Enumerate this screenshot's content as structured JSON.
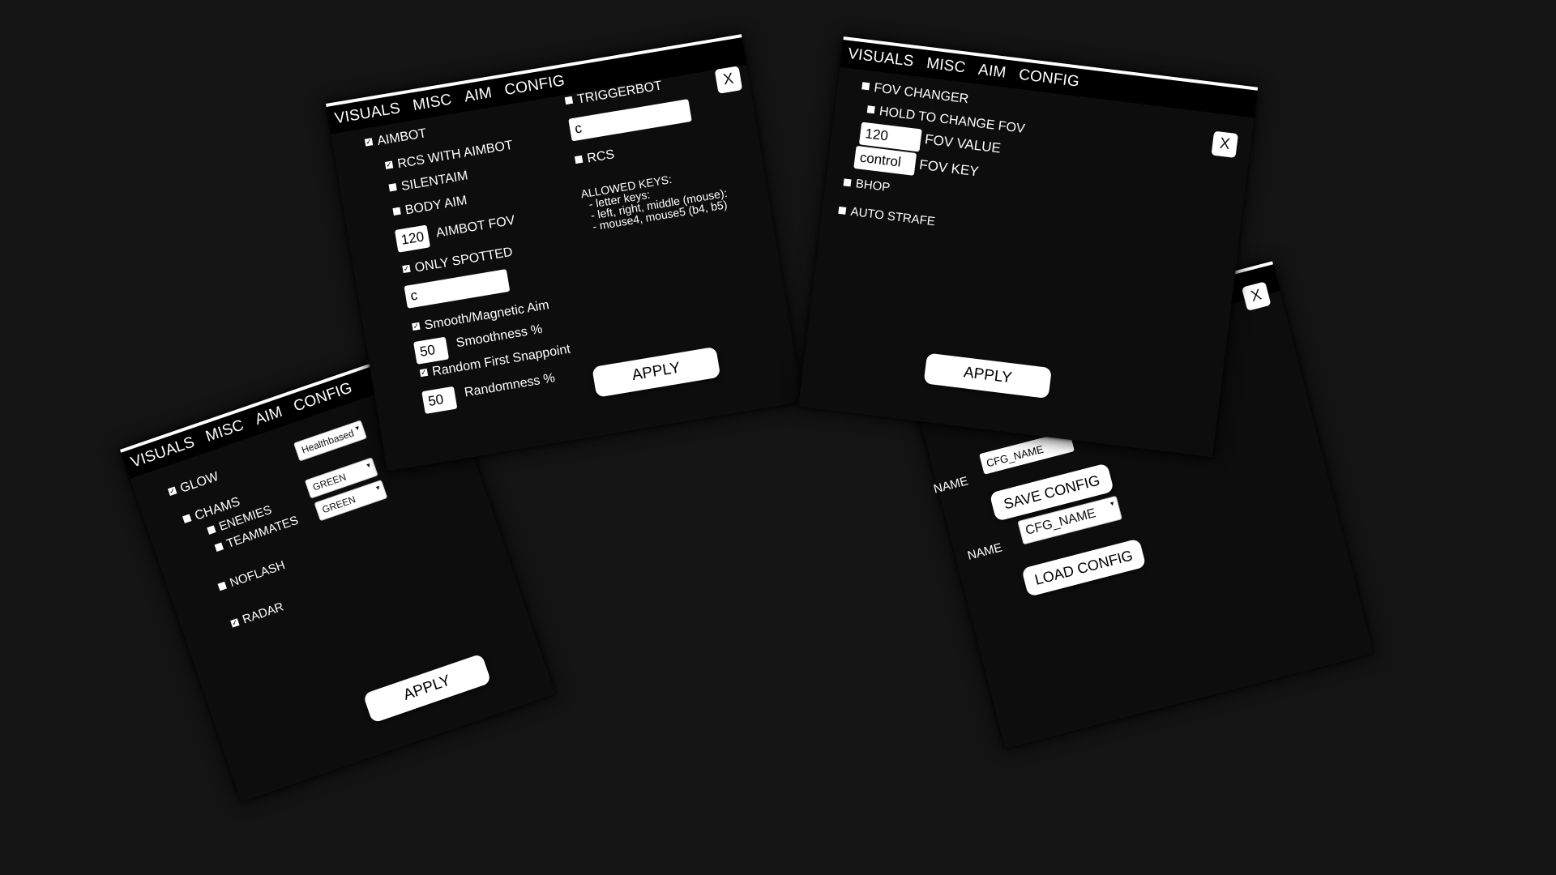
{
  "tabs": [
    "VISUALS",
    "MISC",
    "AIM",
    "CONFIG"
  ],
  "close_label": "X",
  "apply_label": "APPLY",
  "visuals": {
    "glow": {
      "label": "GLOW",
      "checked": true
    },
    "chams": {
      "label": "CHAMS",
      "checked": false
    },
    "enemies": {
      "label": "ENEMIES",
      "checked": false
    },
    "teammates": {
      "label": "TEAMMATES",
      "checked": false
    },
    "noflash": {
      "label": "NOFLASH",
      "checked": false
    },
    "radar": {
      "label": "RADAR",
      "checked": true
    },
    "glow_mode": "Healthbased",
    "enemies_color": "GREEN",
    "teammates_color": "GREEN"
  },
  "aim": {
    "aimbot": {
      "label": "AIMBOT",
      "checked": true
    },
    "rcs_with_aimbot": {
      "label": "RCS WITH AIMBOT",
      "checked": true
    },
    "silentaim": {
      "label": "SILENTAIM",
      "checked": false
    },
    "body_aim": {
      "label": "BODY AIM",
      "checked": false
    },
    "aimbot_fov_value": "120",
    "aimbot_fov_label": "AIMBOT FOV",
    "only_spotted": {
      "label": "ONLY SPOTTED",
      "checked": true
    },
    "aim_key": "c",
    "smooth": {
      "label": "Smooth/Magnetic Aim",
      "checked": true
    },
    "smoothness_value": "50",
    "smoothness_label": "Smoothness %",
    "random_snap": {
      "label": "Random First Snappoint",
      "checked": true
    },
    "randomness_value": "50",
    "randomness_label": "Randomness %",
    "triggerbot": {
      "label": "TRIGGERBOT",
      "checked": false
    },
    "trigger_key": "c",
    "rcs": {
      "label": "RCS",
      "checked": false
    },
    "allowed_keys": "ALLOWED KEYS:\n  - letter keys:\n  - left, right, middle (mouse):\n  - mouse4, mouse5 (b4, b5)"
  },
  "misc": {
    "fov_changer": {
      "label": "FOV CHANGER",
      "checked": false
    },
    "hold_to_change": {
      "label": "HOLD TO CHANGE FOV",
      "checked": false
    },
    "fov_value": "120",
    "fov_value_label": "FOV VALUE",
    "fov_key": "control",
    "fov_key_label": "FOV KEY",
    "bhop": {
      "label": "BHOP",
      "checked": false
    },
    "auto_strafe": {
      "label": "AUTO STRAFE",
      "checked": false
    }
  },
  "config": {
    "name_label": "NAME",
    "save_name": "CFG_NAME",
    "save_button": "SAVE CONFIG",
    "load_name": "CFG_NAME",
    "load_button": "LOAD CONFIG"
  }
}
